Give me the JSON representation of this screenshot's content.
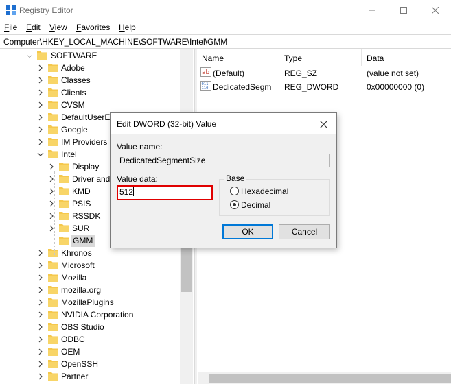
{
  "window": {
    "title": "Registry Editor",
    "controls": {
      "minimize": "minimize-icon",
      "maximize": "maximize-icon",
      "close": "close-icon"
    }
  },
  "menu": [
    "File",
    "Edit",
    "View",
    "Favorites",
    "Help"
  ],
  "address": "Computer\\HKEY_LOCAL_MACHINE\\SOFTWARE\\Intel\\GMM",
  "tree": {
    "root": "SOFTWARE",
    "software_children_before": [
      "Adobe",
      "Classes",
      "Clients",
      "CVSM",
      "DefaultUserEn",
      "Google",
      "IM Providers"
    ],
    "intel": "Intel",
    "intel_children": [
      "Display",
      "Driver and",
      "KMD",
      "PSIS",
      "RSSDK",
      "SUR",
      "GMM"
    ],
    "selected": "GMM",
    "software_children_after": [
      "Khronos",
      "Microsoft",
      "Mozilla",
      "mozilla.org",
      "MozillaPlugins",
      "NVIDIA Corporation",
      "OBS Studio",
      "ODBC",
      "OEM",
      "OpenSSH",
      "Partner"
    ]
  },
  "list": {
    "columns": [
      "Name",
      "Type",
      "Data"
    ],
    "rows": [
      {
        "name": "(Default)",
        "type": "REG_SZ",
        "data": "(value not set)",
        "icon": "string-value-icon"
      },
      {
        "name": "DedicatedSegm",
        "type": "REG_DWORD",
        "data": "0x00000000 (0)",
        "icon": "binary-value-icon"
      }
    ]
  },
  "dialog": {
    "title": "Edit DWORD (32-bit) Value",
    "value_name_label": "Value name:",
    "value_name": "DedicatedSegmentSize",
    "value_data_label": "Value data:",
    "value_data": "512",
    "base_label": "Base",
    "hex_label": "Hexadecimal",
    "dec_label": "Decimal",
    "selected_base": "Decimal",
    "ok": "OK",
    "cancel": "Cancel"
  },
  "colors": {
    "folder": "#f5c84c",
    "accent": "#0078d7",
    "highlight_border": "#e00000"
  }
}
